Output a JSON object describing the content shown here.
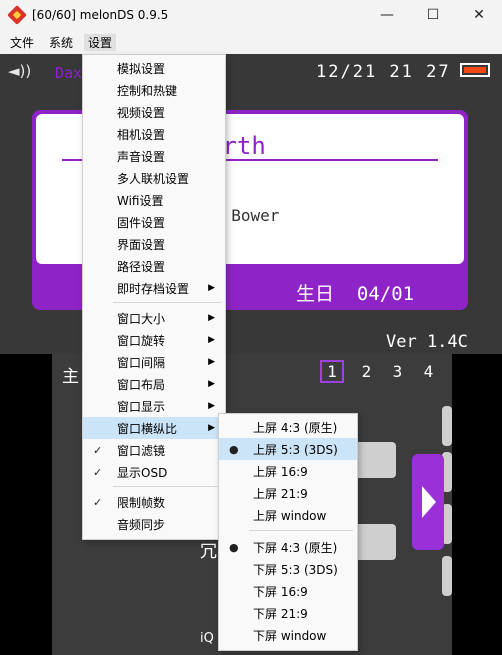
{
  "window": {
    "title": "[60/60] melonDS 0.9.5",
    "controls": [
      "minimize-icon",
      "maximize-icon",
      "close-icon"
    ]
  },
  "menubar": {
    "items": [
      "文件",
      "系统",
      "设置"
    ],
    "active": "设置"
  },
  "top_screen": {
    "user_name": "Dax",
    "clock": "12/21 21 27",
    "card_name": "arth",
    "card_message": "g Bower",
    "birthday_label": "生日",
    "birthday_value": "04/01",
    "version": "Ver 1.4C"
  },
  "bottom_screen": {
    "title_char": "主",
    "pages": [
      "1",
      "2",
      "3",
      "4"
    ],
    "current_page": "1",
    "partial_text": "冗",
    "footer_text": "iQ"
  },
  "settings_menu": {
    "items": [
      {
        "label": "模拟设置",
        "submenu": false,
        "checked": false
      },
      {
        "label": "控制和热键",
        "submenu": false,
        "checked": false
      },
      {
        "label": "视频设置",
        "submenu": false,
        "checked": false
      },
      {
        "label": "相机设置",
        "submenu": false,
        "checked": false
      },
      {
        "label": "声音设置",
        "submenu": false,
        "checked": false
      },
      {
        "label": "多人联机设置",
        "submenu": false,
        "checked": false
      },
      {
        "label": "Wifi设置",
        "submenu": false,
        "checked": false
      },
      {
        "label": "固件设置",
        "submenu": false,
        "checked": false
      },
      {
        "label": "界面设置",
        "submenu": false,
        "checked": false
      },
      {
        "label": "路径设置",
        "submenu": false,
        "checked": false
      },
      {
        "label": "即时存档设置",
        "submenu": true,
        "checked": false
      },
      {
        "label": "窗口大小",
        "submenu": true,
        "checked": false
      },
      {
        "label": "窗口旋转",
        "submenu": true,
        "checked": false
      },
      {
        "label": "窗口间隔",
        "submenu": true,
        "checked": false
      },
      {
        "label": "窗口布局",
        "submenu": true,
        "checked": false
      },
      {
        "label": "窗口显示",
        "submenu": true,
        "checked": false
      },
      {
        "label": "窗口横纵比",
        "submenu": true,
        "checked": false,
        "highlighted": true
      },
      {
        "label": "窗口滤镜",
        "submenu": false,
        "checked": true
      },
      {
        "label": "显示OSD",
        "submenu": false,
        "checked": true
      },
      {
        "label": "限制帧数",
        "submenu": false,
        "checked": true
      },
      {
        "label": "音频同步",
        "submenu": false,
        "checked": false
      }
    ]
  },
  "aspect_submenu": {
    "items": [
      {
        "label": "上屏 4:3 (原生)",
        "selected": false
      },
      {
        "label": "上屏 5:3 (3DS)",
        "selected": true,
        "highlighted": true
      },
      {
        "label": "上屏 16:9",
        "selected": false
      },
      {
        "label": "上屏 21:9",
        "selected": false
      },
      {
        "label": "上屏 window",
        "selected": false
      },
      {
        "label": "下屏 4:3 (原生)",
        "selected": true
      },
      {
        "label": "下屏 5:3 (3DS)",
        "selected": false
      },
      {
        "label": "下屏 16:9",
        "selected": false
      },
      {
        "label": "下屏 21:9",
        "selected": false
      },
      {
        "label": "下屏 window",
        "selected": false
      }
    ]
  },
  "colors": {
    "accent_purple": "#8e24c8",
    "menu_highlight": "#cce4f7",
    "battery": "#ef4a18"
  }
}
